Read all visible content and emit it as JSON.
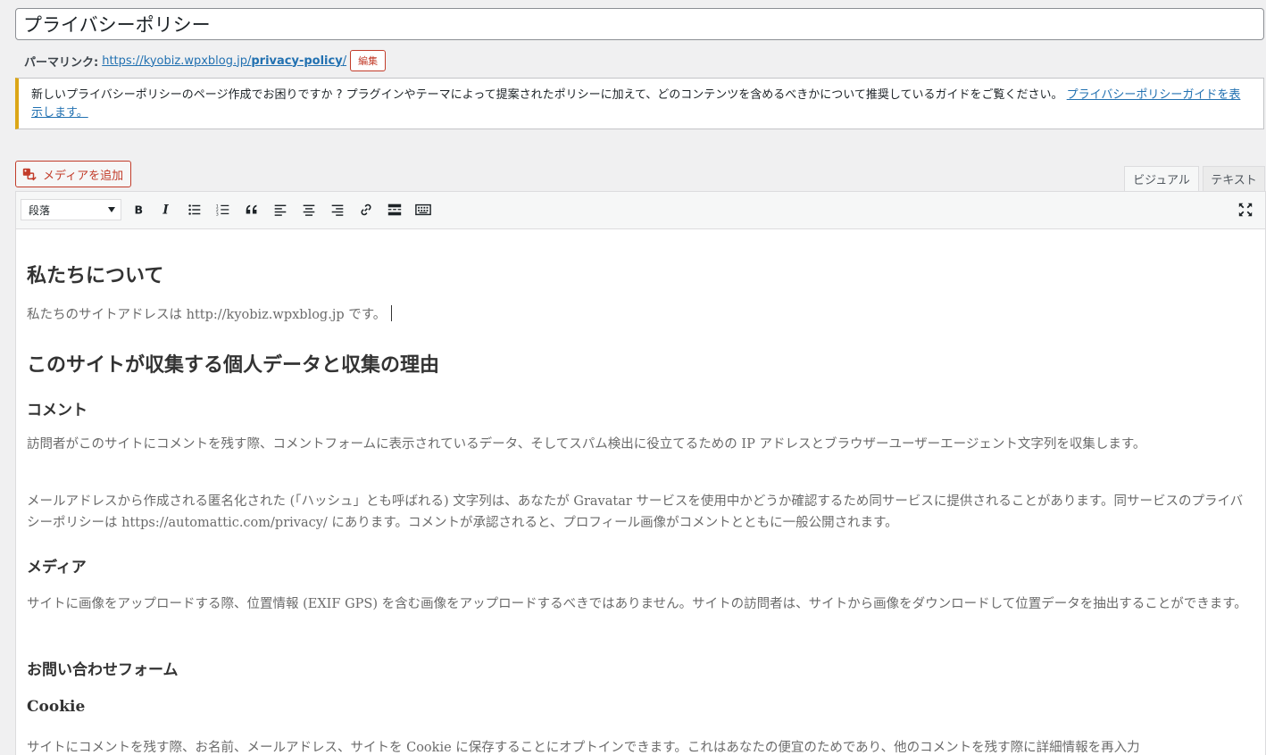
{
  "title": {
    "value": "プライバシーポリシー"
  },
  "permalink": {
    "label": "パーマリンク:",
    "url_base": "https://kyobiz.wpxblog.jp/",
    "url_slug": "privacy-policy",
    "url_trailing": "/",
    "edit_label": "編集"
  },
  "notice": {
    "text": "新しいプライバシーポリシーのページ作成でお困りですか ? プラグインやテーマによって提案されたポリシーに加えて、どのコンテンツを含めるべきかについて推奨しているガイドをご覧ください。",
    "link": "プライバシーポリシーガイドを表示します。"
  },
  "editor": {
    "add_media_label": "メディアを追加",
    "tabs": [
      {
        "label": "ビジュアル",
        "active": true
      },
      {
        "label": "テキスト",
        "active": false
      }
    ],
    "format_select": "段落",
    "toolbar_icons": [
      "bold-icon",
      "italic-icon",
      "bullet-list-icon",
      "numbered-list-icon",
      "blockquote-icon",
      "align-left-icon",
      "align-center-icon",
      "align-right-icon",
      "link-icon",
      "read-more-icon",
      "toolbar-toggle-icon",
      "fullscreen-icon"
    ]
  },
  "content": {
    "h_about": "私たちについて",
    "p_about": "私たちのサイトアドレスは http://kyobiz.wpxblog.jp です。",
    "h_collect": "このサイトが収集する個人データと収集の理由",
    "h_comments": "コメント",
    "p_comments1": "訪問者がこのサイトにコメントを残す際、コメントフォームに表示されているデータ、そしてスパム検出に役立てるための IP アドレスとブラウザーユーザーエージェント文字列を収集します。",
    "p_comments2": "メールアドレスから作成される匿名化された (「ハッシュ」とも呼ばれる) 文字列は、あなたが Gravatar サービスを使用中かどうか確認するため同サービスに提供されることがあります。同サービスのプライバシーポリシーは https://automattic.com/privacy/ にあります。コメントが承認されると、プロフィール画像がコメントとともに一般公開されます。",
    "h_media": "メディア",
    "p_media": "サイトに画像をアップロードする際、位置情報 (EXIF GPS) を含む画像をアップロードするべきではありません。サイトの訪問者は、サイトから画像をダウンロードして位置データを抽出することができます。",
    "h_contact": "お問い合わせフォーム",
    "h_cookie": "Cookie",
    "p_cookie": "サイトにコメントを残す際、お名前、メールアドレス、サイトを Cookie に保存することにオプトインできます。これはあなたの便宜のためであり、他のコメントを残す際に詳細情報を再入力"
  },
  "colors": {
    "link": "#2271b1",
    "danger": "#c23c2a",
    "notice_warning": "#dba617"
  }
}
